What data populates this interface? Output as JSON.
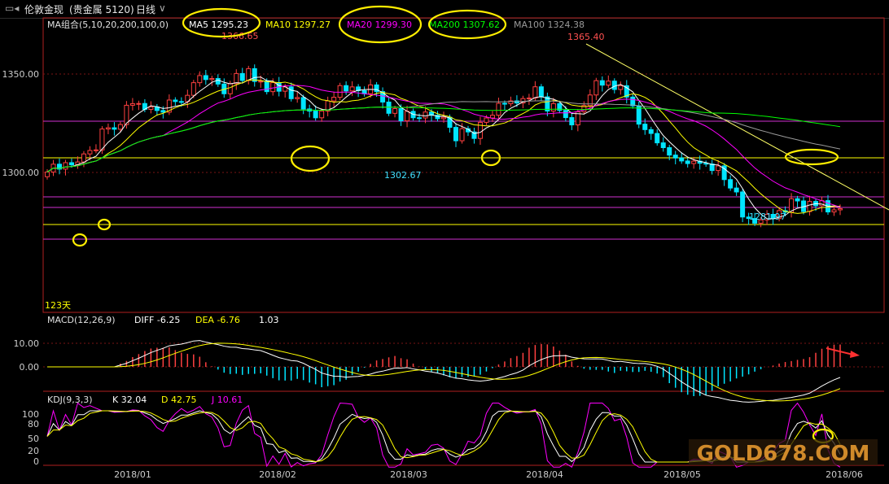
{
  "header": {
    "symbol": "伦敦金现",
    "market": "(贵金属 5120)",
    "period": "日线"
  },
  "ma_legend": {
    "title": "MA组合(5,10,20,200,100,0)",
    "items": [
      {
        "label": "MA5 1295.23",
        "color": "#ffffff"
      },
      {
        "label": "MA10 1297.27",
        "color": "#ffff00"
      },
      {
        "label": "MA20 1299.30",
        "color": "#ff00ff"
      },
      {
        "label": "MA200 1307.62",
        "color": "#00ff00"
      },
      {
        "label": "MA100 1324.38",
        "color": "#9a9a9a"
      }
    ]
  },
  "price_axis": {
    "ticks": [
      "1350.00",
      "1300.00"
    ]
  },
  "annotations": {
    "high1": "1366.65",
    "high2": "1365.40",
    "low1": "1302.67",
    "low2": "1281.97",
    "days": "123天"
  },
  "macd_legend": {
    "title": "MACD(12,26,9)",
    "diff": "DIFF -6.25",
    "dea": "DEA -6.76",
    "macd": "1.03",
    "ticks": [
      "10.00",
      "0.00"
    ]
  },
  "kdj_legend": {
    "title": "KDJ(9,3,3)",
    "k": "K 32.04",
    "d": "D 42.75",
    "j": "J 10.61",
    "ticks": [
      "100",
      "80",
      "50",
      "20",
      "0"
    ]
  },
  "x_axis": {
    "labels": [
      "2018/01",
      "2018/02",
      "2018/03",
      "2018/04",
      "2018/05",
      "2018/06"
    ]
  },
  "watermark": "GOLD678.COM",
  "chart_data": {
    "type": "candlestick",
    "ylim": [
      1253,
      1378
    ],
    "closes": [
      1312.58,
      1315.9,
      1313.81,
      1316.54,
      1315.64,
      1316.84,
      1320.26,
      1321.72,
      1321.96,
      1330.84,
      1331.36,
      1330.74,
      1332.73,
      1340.91,
      1341.59,
      1341.66,
      1339.17,
      1340.22,
      1338.69,
      1337.98,
      1343.13,
      1342.5,
      1342.48,
      1345.14,
      1350.5,
      1353.51,
      1351.83,
      1352.27,
      1349.92,
      1345.8,
      1350.11,
      1354.39,
      1351.44,
      1356.46,
      1351.04,
      1351.15,
      1346.7,
      1350.53,
      1346.88,
      1348.7,
      1343.7,
      1344.19,
      1339.35,
      1338.44,
      1335.59,
      1338.45,
      1342.76,
      1344.31,
      1349.26,
      1347.02,
      1348.7,
      1347.11,
      1345.8,
      1349.56,
      1346.7,
      1342.28,
      1337.49,
      1339.49,
      1334.32,
      1338.33,
      1335.62,
      1335.53,
      1338.05,
      1336.68,
      1335.22,
      1335.81,
      1331.52,
      1325.85,
      1330.96,
      1329.6,
      1326.83,
      1333.66,
      1335.52,
      1336.68,
      1341.74,
      1341.56,
      1342.77,
      1341.87,
      1343.75,
      1343.98,
      1348.75,
      1344.48,
      1338.46,
      1341.63,
      1338.74,
      1335.68,
      1332.58,
      1338.15,
      1340.79,
      1345.28,
      1351.36,
      1349.46,
      1351.16,
      1347.62,
      1349.21,
      1344.4,
      1340.66,
      1332.9,
      1330.58,
      1328.95,
      1324.96,
      1322.92,
      1319.76,
      1318.54,
      1317.27,
      1316.17,
      1317.18,
      1316.28,
      1315.98,
      1313.21,
      1315.18,
      1309.36,
      1305.78,
      1304.12,
      1293.48,
      1292.84,
      1290.85,
      1292.26,
      1294.61,
      1292.82,
      1296.18,
      1295.49,
      1301.24,
      1300.3,
      1295.79,
      1300.09,
      1298.26,
      1300.42,
      1295.63,
      1296.52,
      1297.01
    ],
    "macd": {
      "diff": -6.25,
      "dea": -6.76,
      "macd": 1.03
    },
    "kdj": {
      "k": 32.04,
      "d": 42.75,
      "j": 10.61
    }
  }
}
